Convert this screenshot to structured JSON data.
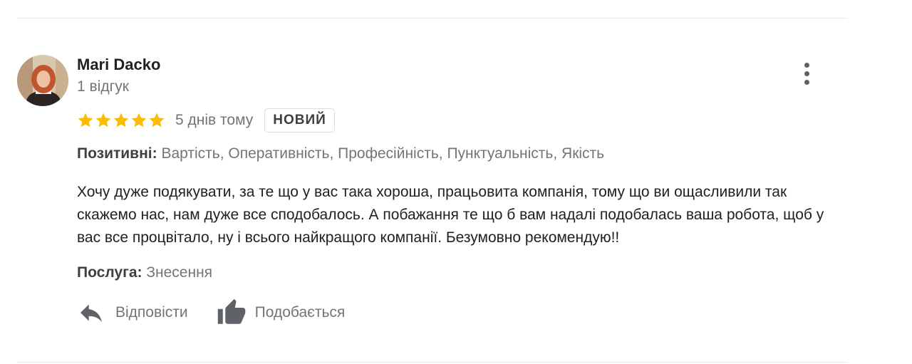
{
  "review": {
    "author_name": "Mari Dacko",
    "review_count": "1 відгук",
    "rating": 5,
    "max_rating": 5,
    "star_color": "#fbbc04",
    "time_ago": "5 днів тому",
    "badge": "НОВИЙ",
    "positives_label": "Позитивні:",
    "positives_value": "Вартість, Оперативність, Професійність, Пунктуальність, Якість",
    "text": "Хочу дуже подякувати, за те що у вас така хороша, працьовита компанія, тому що ви ощасливили так скажемо нас, нам дуже все сподобалось. А побажання те що б вам надалі подобалась ваша робота, щоб у вас все процвітало, ну і всього найкращого компанії. Безумовно рекомендую!!",
    "service_label": "Послуга:",
    "service_value": "Знесення"
  },
  "actions": {
    "reply_label": "Відповісти",
    "reply_icon": "reply-icon",
    "like_label": "Подобається",
    "like_icon": "thumbs-up-icon",
    "more_icon": "more-vert-icon"
  }
}
